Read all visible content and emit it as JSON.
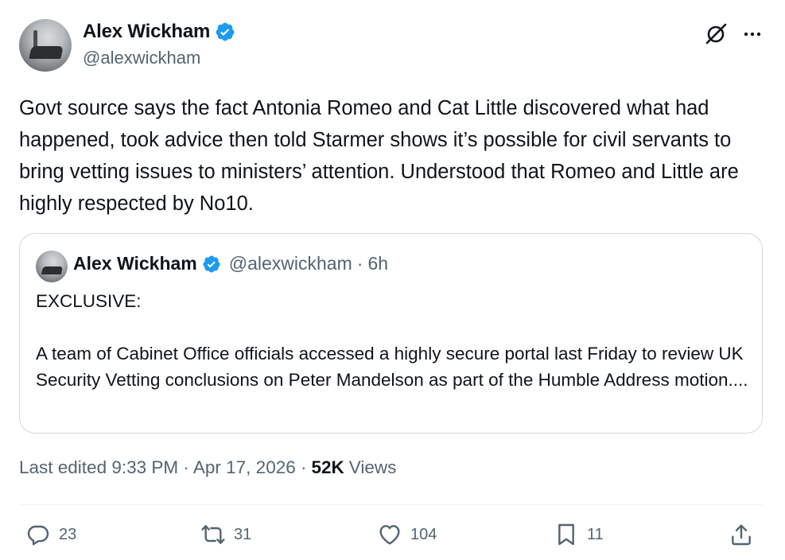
{
  "author": {
    "name": "Alex Wickham",
    "handle": "@alexwickham",
    "verified": true
  },
  "tweet": {
    "text": "Govt source says the fact Antonia Romeo and Cat Little discovered what had happened, took advice then told Starmer shows it’s possible for civil servants to bring vetting issues to ministers’ attention. Understood that Romeo and Little are highly respected by No10."
  },
  "quoted_tweet": {
    "name": "Alex Wickham",
    "handle": "@alexwickham",
    "time": "6h",
    "separator": "·",
    "text": "EXCLUSIVE:\n\nA team of Cabinet Office officials accessed a highly secure portal last Friday to review UK Security Vetting conclusions on Peter Mandelson as part of the Humble Address motion...."
  },
  "meta": {
    "edited": "Last edited 9:33 PM · Apr 17, 2026 ·",
    "views_count": "52K",
    "views_label": "Views"
  },
  "actions": {
    "replies": "23",
    "reposts": "31",
    "likes": "104",
    "bookmarks": "11"
  },
  "icons": {
    "top": [
      "grok-icon",
      "more-icon"
    ],
    "actions": [
      "reply-icon",
      "repost-icon",
      "like-icon",
      "bookmark-icon",
      "share-icon"
    ]
  },
  "colors": {
    "verified": "#1d9bf0",
    "text": "#0f1419",
    "secondary": "#536471",
    "border": "#cfd9de"
  }
}
